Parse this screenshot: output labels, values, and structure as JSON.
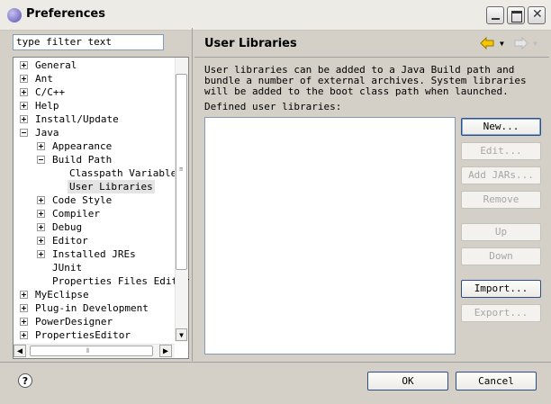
{
  "window": {
    "title": "Preferences"
  },
  "filter": {
    "value": "type filter text"
  },
  "tree": [
    {
      "label": "General",
      "level": 0,
      "expander": "plus"
    },
    {
      "label": "Ant",
      "level": 0,
      "expander": "plus"
    },
    {
      "label": "C/C++",
      "level": 0,
      "expander": "plus"
    },
    {
      "label": "Help",
      "level": 0,
      "expander": "plus"
    },
    {
      "label": "Install/Update",
      "level": 0,
      "expander": "plus"
    },
    {
      "label": "Java",
      "level": 0,
      "expander": "minus"
    },
    {
      "label": "Appearance",
      "level": 1,
      "expander": "plus"
    },
    {
      "label": "Build Path",
      "level": 1,
      "expander": "minus"
    },
    {
      "label": "Classpath Variables",
      "level": 2,
      "expander": "none"
    },
    {
      "label": "User Libraries",
      "level": 2,
      "expander": "none",
      "selected": true
    },
    {
      "label": "Code Style",
      "level": 1,
      "expander": "plus"
    },
    {
      "label": "Compiler",
      "level": 1,
      "expander": "plus"
    },
    {
      "label": "Debug",
      "level": 1,
      "expander": "plus"
    },
    {
      "label": "Editor",
      "level": 1,
      "expander": "plus"
    },
    {
      "label": "Installed JREs",
      "level": 1,
      "expander": "plus"
    },
    {
      "label": "JUnit",
      "level": 1,
      "expander": "none"
    },
    {
      "label": "Properties Files Editor",
      "level": 1,
      "expander": "none"
    },
    {
      "label": "MyEclipse",
      "level": 0,
      "expander": "plus"
    },
    {
      "label": "Plug-in Development",
      "level": 0,
      "expander": "plus"
    },
    {
      "label": "PowerDesigner",
      "level": 0,
      "expander": "plus"
    },
    {
      "label": "PropertiesEditor",
      "level": 0,
      "expander": "plus"
    }
  ],
  "page": {
    "title": "User Libraries",
    "description": "User libraries can be added to a Java Build path and bundle a number of external archives. System libraries will be added to the boot class path when launched.",
    "defined_label": "Defined user libraries:"
  },
  "buttons": [
    {
      "label": "New...",
      "enabled": true,
      "default": true
    },
    {
      "label": "Edit...",
      "enabled": false
    },
    {
      "label": "Add JARs...",
      "enabled": false
    },
    {
      "label": "Remove",
      "enabled": false
    },
    {
      "label": "Up",
      "enabled": false
    },
    {
      "label": "Down",
      "enabled": false
    },
    {
      "label": "Import...",
      "enabled": true
    },
    {
      "label": "Export...",
      "enabled": false
    }
  ],
  "dialog": {
    "ok_label": "OK",
    "cancel_label": "Cancel"
  },
  "icons": {
    "app": "eclipse-icon",
    "back": "back-arrow-icon",
    "forward": "forward-arrow-icon",
    "help": "help-icon"
  },
  "colors": {
    "nav_arrow": "#e8b400"
  }
}
